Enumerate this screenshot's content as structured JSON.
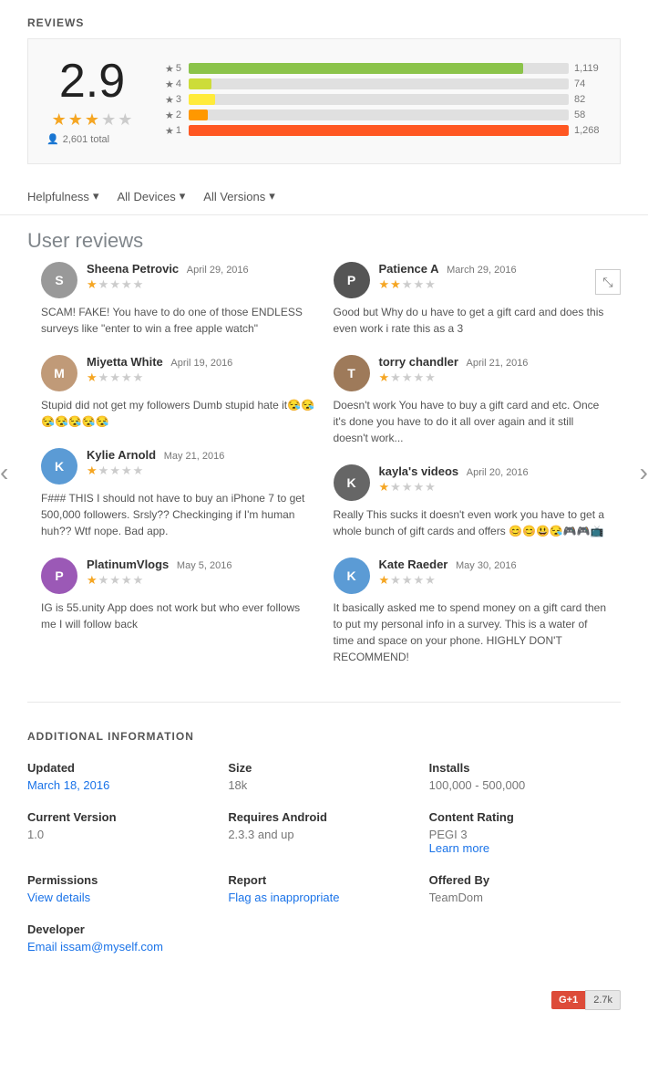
{
  "page": {
    "title": "REVIEWS"
  },
  "ratingSummary": {
    "score": "2.9",
    "total": "2,601 total",
    "bars": [
      {
        "stars": 5,
        "count": "1,119",
        "color": "#8bc34a",
        "percent": 88
      },
      {
        "stars": 4,
        "count": "74",
        "color": "#cddc39",
        "percent": 6
      },
      {
        "stars": 3,
        "count": "82",
        "color": "#ffeb3b",
        "percent": 7
      },
      {
        "stars": 2,
        "count": "58",
        "color": "#ff9800",
        "percent": 5
      },
      {
        "stars": 1,
        "count": "1,268",
        "color": "#ff5722",
        "percent": 100
      }
    ]
  },
  "filters": [
    {
      "label": "Helpfulness",
      "key": "helpfulness"
    },
    {
      "label": "All Devices",
      "key": "devices"
    },
    {
      "label": "All Versions",
      "key": "versions"
    }
  ],
  "userReviewsHeader": "User reviews",
  "reviews": [
    {
      "id": "sheena",
      "name": "Sheena Petrovic",
      "date": "April 29, 2016",
      "stars": 1,
      "avatarColor": "#bbb",
      "avatarLabel": "S",
      "avatarType": "image-gray",
      "text": "SCAM! FAKE! You have to do one of those ENDLESS surveys like \"enter to win a free apple watch\""
    },
    {
      "id": "miyetta",
      "name": "Miyetta White",
      "date": "April 19, 2016",
      "stars": 1,
      "avatarColor": "#c0956e",
      "avatarLabel": "M",
      "avatarType": "image-brown",
      "text": "Stupid did not get my followers Dumb stupid hate it😪😪😪😪😪😪😪"
    },
    {
      "id": "kylie",
      "name": "Kylie Arnold",
      "date": "May 21, 2016",
      "stars": 1,
      "avatarColor": "#5b9bd5",
      "avatarLabel": "K",
      "avatarType": "blue",
      "text": "F### THIS I should not have to buy an iPhone 7 to get 500,000 followers. Srsly?? Checkinging if I'm human huh?? Wtf nope. Bad app."
    },
    {
      "id": "platinum",
      "name": "PlatinumVlogs",
      "date": "May 5, 2016",
      "stars": 1,
      "avatarColor": "#cc00cc",
      "avatarLabel": "P",
      "avatarType": "purple",
      "text": "IG is 55.unity App does not work but who ever follows me I will follow back"
    }
  ],
  "reviewsRight": [
    {
      "id": "patience",
      "name": "Patience A",
      "date": "March 29, 2016",
      "stars": 2,
      "avatarColor": "#888",
      "avatarLabel": "P",
      "avatarType": "image-dark",
      "text": "Good but Why do u have to get a gift card and does this even work i rate this as a 3"
    },
    {
      "id": "torry",
      "name": "torry chandler",
      "date": "April 21, 2016",
      "stars": 1,
      "avatarColor": "#9e6b4a",
      "avatarLabel": "T",
      "avatarType": "image-brown2",
      "text": "Doesn't work You have to buy a gift card and etc. Once it's done you have to do it all over again and it still doesn't work..."
    },
    {
      "id": "kayla",
      "name": "kayla's videos",
      "date": "April 20, 2016",
      "stars": 1,
      "avatarColor": "#666",
      "avatarLabel": "K",
      "avatarType": "image-dark2",
      "text": "Really This sucks it doesn't even work you have to get a whole bunch of gift cards and offers 😊😊😃😪🎮🎮📺"
    },
    {
      "id": "kate",
      "name": "Kate Raeder",
      "date": "May 30, 2016",
      "stars": 1,
      "avatarColor": "#5b9bd5",
      "avatarLabel": "K",
      "avatarType": "blue",
      "text": "It basically asked me to spend money on a gift card then to put my personal info in a survey. This is a water of time and space on your phone. HIGHLY DON'T RECOMMEND!"
    }
  ],
  "additionalInfo": {
    "title": "ADDITIONAL INFORMATION",
    "items": [
      {
        "label": "Updated",
        "value": "March 18, 2016",
        "link": true
      },
      {
        "label": "Size",
        "value": "18k",
        "link": false
      },
      {
        "label": "Installs",
        "value": "100,000 - 500,000",
        "link": false
      },
      {
        "label": "Current Version",
        "value": "1.0",
        "link": false
      },
      {
        "label": "Requires Android",
        "value": "2.3.3 and up",
        "link": false
      },
      {
        "label": "Content Rating",
        "value": "PEGI 3",
        "link": false,
        "subValue": "Learn more",
        "subLink": true
      },
      {
        "label": "Permissions",
        "value": "View details",
        "link": true
      },
      {
        "label": "Report",
        "value": "Flag as inappropriate",
        "link": true
      },
      {
        "label": "Offered By",
        "value": "TeamDom",
        "link": false
      },
      {
        "label": "Developer",
        "value": "Email issam@myself.com",
        "link": true
      }
    ]
  },
  "gplus": {
    "badge": "G+1",
    "count": "2.7k"
  }
}
